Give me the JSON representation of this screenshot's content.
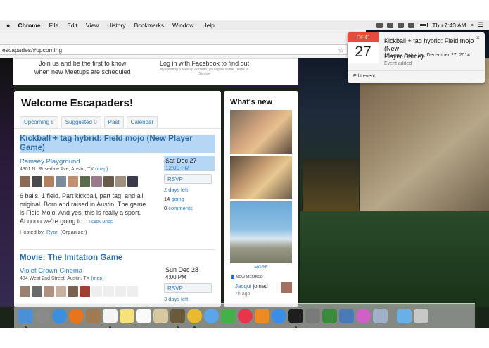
{
  "menubar": {
    "apple": "",
    "items": [
      "Chrome",
      "File",
      "Edit",
      "View",
      "History",
      "Bookmarks",
      "Window",
      "Help"
    ],
    "clock": "Thu 7:43 AM"
  },
  "browser": {
    "url": "escapades/#upcoming"
  },
  "topcard": {
    "left": [
      "Join us and be the first to know",
      "when new Meetups are scheduled"
    ],
    "right": "Log in with Facebook to find out",
    "fineprint": [
      "By creating a Meetup account, you agree to the Terms of",
      "Service"
    ]
  },
  "main": {
    "title": "Welcome Escapaders!",
    "tabs": [
      {
        "label": "Upcoming",
        "count": "8"
      },
      {
        "label": "Suggested",
        "count": "0"
      },
      {
        "label": "Past",
        "count": ""
      },
      {
        "label": "Calendar",
        "count": ""
      }
    ],
    "events": [
      {
        "title_lines": [
          "Kickball + tag hybrid: Field mojo (New Player",
          "Game)"
        ],
        "venue": "Ramsey Playground",
        "address": "4301 N. Rosedale Ave, Austin, TX",
        "map": "(map)",
        "desc_lines": [
          "6 balls, 1 field. Part kickball, part tag, and all",
          "original. Born and raised in Austin. The game",
          "is Field Mojo. And yes, this is really a sport.",
          "At noon we're going to..."
        ],
        "learn_more": "LEARN MORE",
        "hosted_prefix": "Hosted by:",
        "host": "Ryan",
        "host_role": "(Organizer)",
        "date": "Sat Dec 27",
        "time": "12:00 PM",
        "rsvp": "RSVP",
        "days_left": "2 days left",
        "going_num": "14",
        "going": "going",
        "comments_num": "0",
        "comments": "comments"
      },
      {
        "title_lines": [
          "Movie: The Imitation Game"
        ],
        "venue": "Violet Crown Cinema",
        "address": "434 West 2nd Street, Austin, TX",
        "map": "(map)",
        "date": "Sun Dec 28",
        "time": "4:00 PM",
        "rsvp": "RSVP",
        "days_left": "3 days left"
      }
    ]
  },
  "whatsnew": {
    "title": "What's new",
    "more": "MORE",
    "new_member_label": "NEW MEMBER",
    "member": "Jacqui",
    "action": "joined",
    "ago": "7h ago"
  },
  "notification": {
    "month": "DEC",
    "day": "27",
    "title_lines": [
      "Kickball + tag hybrid: Field mojo (New",
      "Player Game)"
    ],
    "time": "12 noon, Saturday, December 27, 2014",
    "status": "Event added",
    "edit": "Edit event",
    "close": "×"
  },
  "colors": {
    "accent": "#2f7bbf",
    "highlight": "#b6d6f5",
    "calendar_red": "#e74b3c"
  }
}
